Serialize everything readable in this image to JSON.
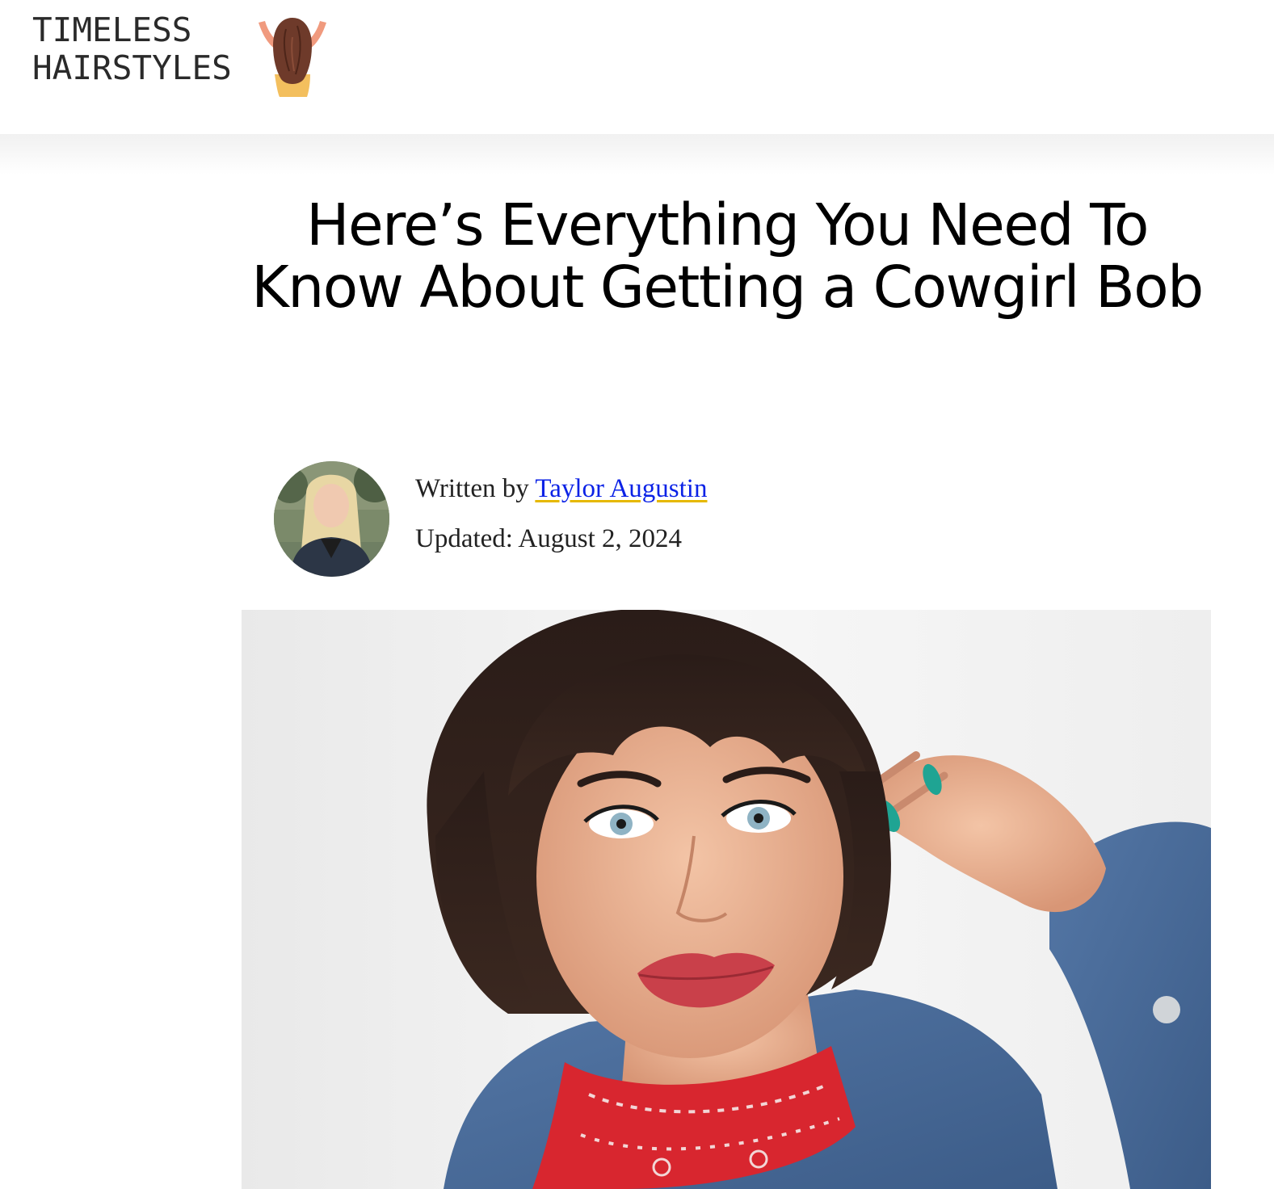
{
  "site": {
    "name_line1": "TIMELESS",
    "name_line2": "HAIRSTYLES",
    "logo_icon": "woman-hair-back-icon"
  },
  "article": {
    "title": "Here’s Everything You Need To Know About Getting a Cowgirl Bob",
    "byline": {
      "written_by_prefix": "Written by",
      "author_name": "Taylor Augustin",
      "updated_prefix": "Updated:",
      "updated_date": "August 2, 2024"
    },
    "hero_image": "woman-with-cowgirl-bob-and-red-bandana-photo"
  },
  "colors": {
    "link": "#0b22e6",
    "link_underline": "#e6b800",
    "title": "#000000",
    "logo_text": "#2a2a2a"
  }
}
